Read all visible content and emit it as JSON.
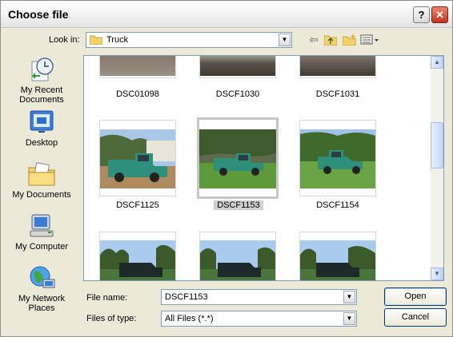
{
  "window": {
    "title": "Choose file",
    "help_label": "?",
    "close_label": "✕"
  },
  "lookin": {
    "label": "Look in:",
    "value": "Truck"
  },
  "toolbar": {
    "back_icon": "back-arrow-icon",
    "up_icon": "up-folder-icon",
    "new_folder_icon": "new-folder-icon",
    "views_icon": "views-menu-icon"
  },
  "places": [
    {
      "label_line1": "My Recent",
      "label_line2": "Documents",
      "icon": "recent-documents-icon"
    },
    {
      "label_line1": "Desktop",
      "label_line2": "",
      "icon": "desktop-icon"
    },
    {
      "label_line1": "My Documents",
      "label_line2": "",
      "icon": "my-documents-icon"
    },
    {
      "label_line1": "My Computer",
      "label_line2": "",
      "icon": "my-computer-icon"
    },
    {
      "label_line1": "My Network",
      "label_line2": "Places",
      "icon": "network-places-icon"
    }
  ],
  "files": [
    {
      "name": "DSC01098",
      "selected": false
    },
    {
      "name": "DSCF1030",
      "selected": false
    },
    {
      "name": "DSCF1031",
      "selected": false
    },
    {
      "name": "DSCF1125",
      "selected": false
    },
    {
      "name": "DSCF1153",
      "selected": true
    },
    {
      "name": "DSCF1154",
      "selected": false
    }
  ],
  "filename": {
    "label": "File name:",
    "value": "DSCF1153"
  },
  "filetype": {
    "label": "Files of type:",
    "value": "All Files (*.*)"
  },
  "buttons": {
    "open": "Open",
    "cancel": "Cancel"
  },
  "colors": {
    "truck_green": "#2e8f7b",
    "grass": "#5f9a3a",
    "sky": "#9fc3e8",
    "selection": "#cfcfcf"
  }
}
